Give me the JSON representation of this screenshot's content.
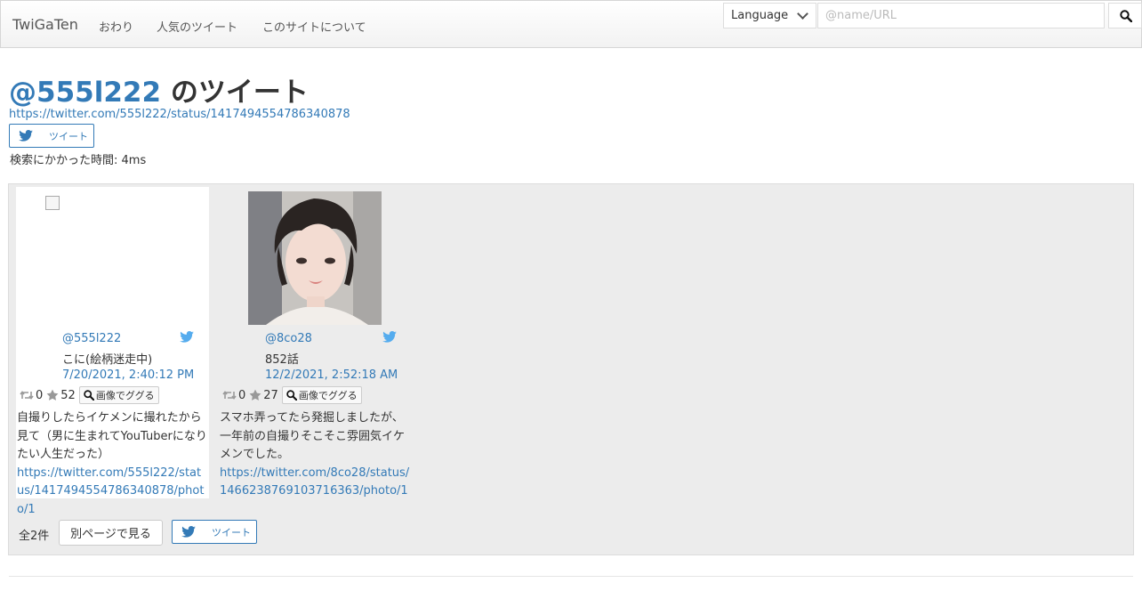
{
  "navbar": {
    "brand": "TwiGaTen",
    "links": [
      "おわり",
      "人気のツイート",
      "このサイトについて"
    ],
    "language_label": "Language",
    "search_placeholder": "@name/URL"
  },
  "header": {
    "user": "@555l222",
    "title_suffix": " のツイート",
    "status_url": "https://twitter.com/555l222/status/1417494554786340878",
    "tweet_button": "ツイート",
    "search_time": "検索にかかった時間: 4ms"
  },
  "cards": [
    {
      "user": "@555l222",
      "display_name": "こに(絵柄迷走中)",
      "date": "7/20/2021, 2:40:12 PM",
      "retweets": "0",
      "likes": "52",
      "google_button": "画像でググる",
      "text": "自撮りしたらイケメンに撮れたから見て（男に生まれてYouTuberになりたい人生だった）",
      "link": "https://twitter.com/555l222/status/1417494554786340878/photo/1"
    },
    {
      "user": "@8co28",
      "display_name": "852話",
      "date": "12/2/2021, 2:52:18 AM",
      "retweets": "0",
      "likes": "27",
      "google_button": "画像でググる",
      "text": "スマホ弄ってたら発掘しましたが、一年前の自撮りそこそこ雰囲気イケメンでした。",
      "link": "https://twitter.com/8co28/status/1466238769103716363/photo/1"
    }
  ],
  "footer": {
    "count": "全2件",
    "other_page": "別ページで見る",
    "tweet_button": "ツイート"
  },
  "colors": {
    "link": "#337ab7",
    "twitter": "#55acee",
    "panel": "#ececec"
  }
}
